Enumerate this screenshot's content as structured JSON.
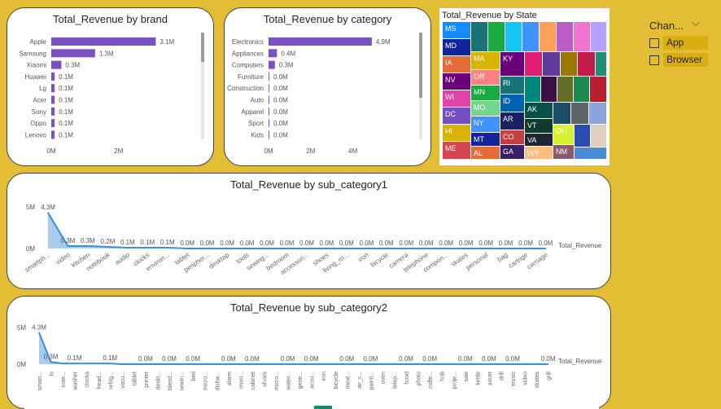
{
  "colors": {
    "background": "#E3BD33",
    "bar": "#7B50C3",
    "area_fill": "#A9CCEC",
    "line": "#3B8FDC",
    "slicer_label_bg": "#D9AE10"
  },
  "chart_data": [
    {
      "type": "bar",
      "orientation": "horizontal",
      "title": "Total_Revenue by brand",
      "categories": [
        "Apple",
        "Samsung",
        "Xiaomi",
        "Huawei",
        "Lg",
        "Acer",
        "Sony",
        "Oppo",
        "Lenovo"
      ],
      "values": [
        3.1,
        1.3,
        0.3,
        0.1,
        0.1,
        0.1,
        0.1,
        0.1,
        0.1
      ],
      "labels": [
        "3.1M",
        "1.3M",
        "0.3M",
        "0.1M",
        "0.1M",
        "0.1M",
        "0.1M",
        "0.1M",
        "0.1M"
      ],
      "unit": "M",
      "xticks": [
        "0M",
        "2M"
      ],
      "xtick_values": [
        0,
        2
      ],
      "xlim": [
        0,
        3.5
      ]
    },
    {
      "type": "bar",
      "orientation": "horizontal",
      "title": "Total_Revenue by category",
      "categories": [
        "Electronics",
        "Appliances",
        "Computers",
        "Furniture",
        "Construction",
        "Auto",
        "Apparel",
        "Sport",
        "Kids"
      ],
      "values": [
        4.9,
        0.4,
        0.3,
        0.0,
        0.0,
        0.0,
        0.0,
        0.0,
        0.0
      ],
      "labels": [
        "4.9M",
        "0.4M",
        "0.3M",
        "0.0M",
        "0.0M",
        "0.0M",
        "0.0M",
        "0.0M",
        "0.0M"
      ],
      "unit": "M",
      "xticks": [
        "0M",
        "2M",
        "4M"
      ],
      "xtick_values": [
        0,
        2,
        4
      ],
      "xlim": [
        0,
        5.6
      ]
    },
    {
      "type": "heatmap",
      "subtype": "treemap",
      "title": "Total_Revenue by State",
      "labels": [
        "MS",
        "MD",
        "IA",
        "NV",
        "WI",
        "DC",
        "HI",
        "ME",
        "MA",
        "OR",
        "MN",
        "MO",
        "NY",
        "MT",
        "AL",
        "KY",
        "RI",
        "ID",
        "AR",
        "CO",
        "GA",
        "AK",
        "VT",
        "VA",
        "OH",
        "WY",
        "NM"
      ]
    },
    {
      "type": "area",
      "title": "Total_Revenue by sub_category1",
      "series_label": "Total_Revenue",
      "yticks": [
        "5M",
        "0M"
      ],
      "ylim": [
        0,
        5
      ],
      "categories": [
        "smartph...",
        "video",
        "kitchen",
        "notebook",
        "audio",
        "clocks",
        "environ...",
        "tablet",
        "peripher...",
        "desktop",
        "tools",
        "sewing...",
        "bedroom",
        "accessori...",
        "shoes",
        "living_ro...",
        "iron",
        "bicycle",
        "camera",
        "telephone",
        "compon...",
        "skates",
        "personal",
        "bag",
        "cartrige",
        "carriage"
      ],
      "values": [
        4.3,
        0.3,
        0.3,
        0.2,
        0.1,
        0.1,
        0.1,
        0.0,
        0.0,
        0.0,
        0.0,
        0.0,
        0.0,
        0.0,
        0.0,
        0.0,
        0.0,
        0.0,
        0.0,
        0.0,
        0.0,
        0.0,
        0.0,
        0.0,
        0.0,
        0.0
      ],
      "labels": [
        "4.3M",
        "0.3M",
        "0.3M",
        "0.2M",
        "0.1M",
        "0.1M",
        "0.1M",
        "0.0M",
        "0.0M",
        "0.0M",
        "0.0M",
        "0.0M",
        "0.0M",
        "0.0M",
        "0.0M",
        "0.0M",
        "0.0M",
        "0.0M",
        "0.0M",
        "0.0M",
        "0.0M",
        "0.0M",
        "0.0M",
        "0.0M",
        "0.0M",
        "0.0M"
      ]
    },
    {
      "type": "area",
      "title": "Total_Revenue by sub_category2",
      "series_label": "Total_Revenue",
      "yticks": [
        "5M",
        "0M"
      ],
      "ylim": [
        0,
        5
      ],
      "categories": [
        "smart...",
        "tv",
        "note...",
        "washer",
        "clocks",
        "head...",
        "refrig...",
        "vacu...",
        "tablet",
        "printer",
        "deskt...",
        "blend...",
        "sewin...",
        "bed",
        "micro...",
        "dishw...",
        "alarm",
        "moni...",
        "cabinet",
        "shoes",
        "micro...",
        "water...",
        "gene...",
        "acou...",
        "iron",
        "bicycle",
        "meat...",
        "air_c...",
        "painti...",
        "oven",
        "telep...",
        "hood",
        "photo",
        "coffe...",
        "hob",
        "proje...",
        "saw",
        "kettle",
        "juicer",
        "drill",
        "music",
        "video",
        "skates",
        "grill"
      ],
      "values": [
        4.3,
        0.3,
        0.1,
        0.1,
        0.1,
        0.1,
        0.1,
        0.0,
        0.0,
        0.0,
        0.0,
        0.0,
        0.0,
        0.0,
        0.0,
        0.0,
        0.0,
        0.0,
        0.0,
        0.0,
        0.0,
        0.0,
        0.0,
        0.0,
        0.0,
        0.0,
        0.0,
        0.0,
        0.0,
        0.0,
        0.0,
        0.0,
        0.0,
        0.0,
        0.0,
        0.0,
        0.0,
        0.0,
        0.0,
        0.0,
        0.0,
        0.0,
        0.0,
        0.0
      ],
      "labels": [
        "4.3M",
        "0.3M",
        "",
        "0.1M",
        "",
        "",
        "0.1M",
        "",
        "",
        "0.0M",
        "",
        "0.0M",
        "",
        "0.0M",
        "",
        "",
        "0.0M",
        "",
        "0.0M",
        "",
        "",
        "0.0M",
        "",
        "0.0M",
        "",
        "",
        "0.0M",
        "",
        "0.0M",
        "",
        "",
        "0.0M",
        "",
        "0.0M",
        "",
        "",
        "0.0M",
        "",
        "0.0M",
        "",
        "0.0M",
        "",
        "",
        "0.0M"
      ]
    }
  ],
  "slicer": {
    "title": "Chan...",
    "items": [
      "App",
      "Browser"
    ]
  }
}
